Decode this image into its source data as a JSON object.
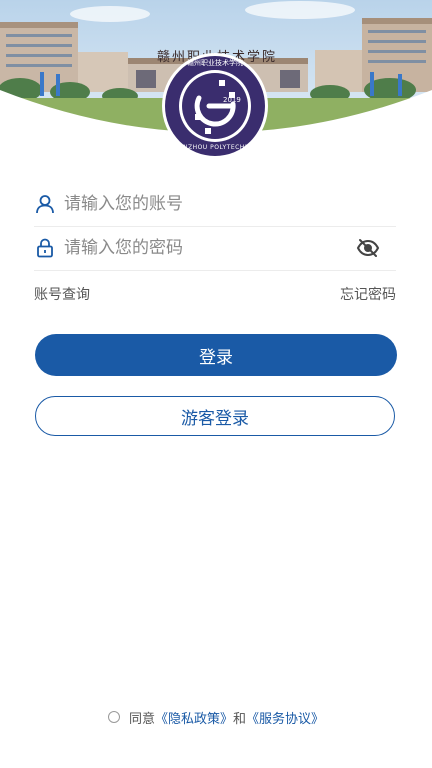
{
  "header": {
    "building_sign": "赣州职业技术学院",
    "logo_year": "2019",
    "logo_ring_text": "GANZHOU POLYTECHNIC",
    "logo_inner_text": "赣州职业技术学院"
  },
  "login": {
    "account_placeholder": "请输入您的账号",
    "password_placeholder": "请输入您的密码",
    "account_lookup_label": "账号查询",
    "forgot_password_label": "忘记密码",
    "login_button_label": "登录",
    "guest_login_label": "游客登录"
  },
  "agreement": {
    "agree_label": "同意",
    "privacy_policy_link": "《隐私政策》",
    "and_label": "和",
    "service_agreement_link": "《服务协议》"
  },
  "colors": {
    "primary": "#1a5aa6",
    "logo_navy": "#3a2d6e"
  },
  "icons": {
    "account": "user-icon",
    "password": "lock-icon",
    "toggle_password": "eye-off-icon"
  }
}
